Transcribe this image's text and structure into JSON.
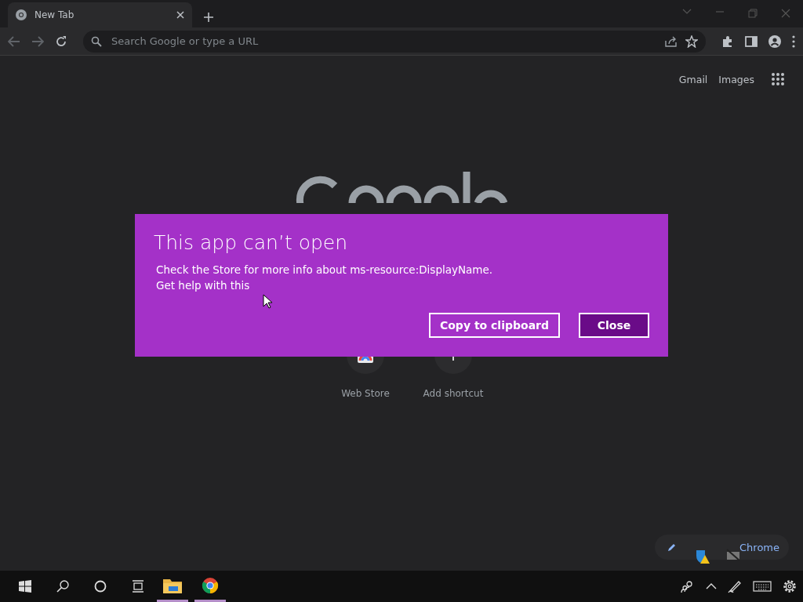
{
  "browser": {
    "tab": {
      "title": "New Tab",
      "selected": true
    },
    "address_bar": {
      "placeholder": "Search Google or type a URL"
    }
  },
  "new_tab_page": {
    "header_links": [
      "Gmail",
      "Images"
    ],
    "shortcuts": [
      {
        "label": "Web Store",
        "kind": "store"
      },
      {
        "label": "Add shortcut",
        "kind": "add"
      }
    ],
    "customize_chip": {
      "label": "Chrome"
    }
  },
  "dialog": {
    "title": "This app can’t open",
    "message": "Check the Store for more info about ms-resource:DisplayName.",
    "help_link": "Get help with this",
    "buttons": [
      {
        "label": "Copy to clipboard",
        "kind": "secondary"
      },
      {
        "label": "Close",
        "kind": "primary"
      }
    ]
  },
  "taskbar": {
    "apps": [
      {
        "kind": "files",
        "open": true
      },
      {
        "kind": "chrome",
        "open": true
      }
    ]
  }
}
